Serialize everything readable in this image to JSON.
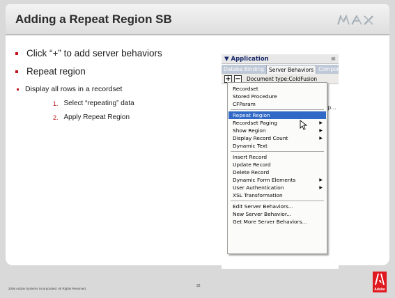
{
  "slide": {
    "title": "Adding a Repeat Region SB",
    "brand": "MAX",
    "bullets": [
      "Click “+” to add server behaviors",
      "Repeat region"
    ],
    "sub_bullet": "Display all rows in a recordset",
    "steps": [
      {
        "num": "1.",
        "text": "Select “repeating” data"
      },
      {
        "num": "2.",
        "text": "Apply Repeat Region"
      }
    ]
  },
  "panel": {
    "title": "▼ Application",
    "options_icon": "≡",
    "tabs": [
      "Databa Binding",
      "Server Behaviors",
      "Compor"
    ],
    "active_tab": 1,
    "add_button": "+",
    "remove_button": "−",
    "document_type": "Document type:ColdFusion",
    "truncated_text": "p...",
    "menu": {
      "groups": [
        [
          {
            "label": "Recordset",
            "submenu": false
          },
          {
            "label": "Stored Procedure",
            "submenu": false
          },
          {
            "label": "CFParam",
            "submenu": false
          }
        ],
        [
          {
            "label": "Repeat Region",
            "submenu": false,
            "highlighted": true
          },
          {
            "label": "Recordset Paging",
            "submenu": true
          },
          {
            "label": "Show Region",
            "submenu": true
          },
          {
            "label": "Display Record Count",
            "submenu": true
          },
          {
            "label": "Dynamic Text",
            "submenu": false
          }
        ],
        [
          {
            "label": "Insert Record",
            "submenu": false
          },
          {
            "label": "Update Record",
            "submenu": false
          },
          {
            "label": "Delete Record",
            "submenu": false
          },
          {
            "label": "Dynamic Form Elements",
            "submenu": true
          },
          {
            "label": "User Authentication",
            "submenu": true
          },
          {
            "label": "XSL Transformation",
            "submenu": false
          }
        ],
        [
          {
            "label": "Edit Server Behaviors...",
            "submenu": false
          },
          {
            "label": "New Server Behavior...",
            "submenu": false
          },
          {
            "label": "Get More Server Behaviors...",
            "submenu": false
          }
        ]
      ]
    }
  },
  "footer": {
    "copyright": "2006 Adobe Systems Incorporated.  All Rights Reserved.",
    "page_number": "32",
    "logo_text": "Adobe"
  },
  "colors": {
    "accent": "#c0141b",
    "menu_highlight": "#3169c6",
    "adobe_red": "#e0181f"
  }
}
